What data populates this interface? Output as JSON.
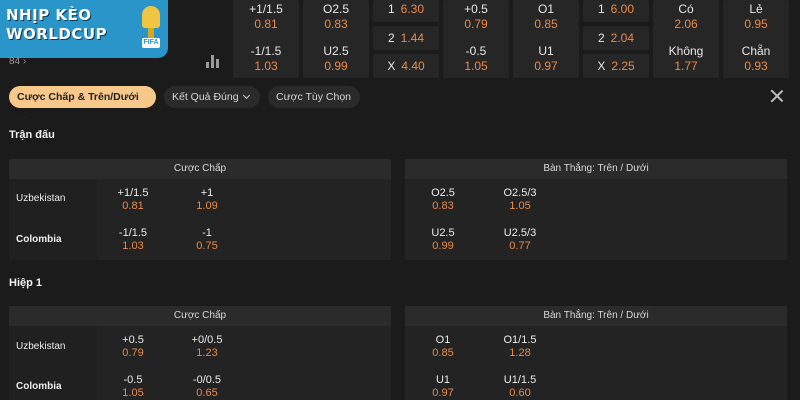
{
  "logo": {
    "line1": "NHỊP KÈO",
    "line2": "WORLDCUP",
    "badge": "FIFA"
  },
  "match_count": "84 ›",
  "top_odds": {
    "handicap": [
      {
        "line": "+1/1.5",
        "odds": "0.81"
      },
      {
        "line": "-1/1.5",
        "odds": "1.03"
      }
    ],
    "over_under": [
      {
        "line": "O2.5",
        "odds": "0.83"
      },
      {
        "line": "U2.5",
        "odds": "0.99"
      }
    ],
    "result_1x2": [
      {
        "label": "1",
        "odds": "6.30"
      },
      {
        "label": "2",
        "odds": "1.44"
      },
      {
        "label": "X",
        "odds": "4.40"
      }
    ],
    "ht_handicap": [
      {
        "line": "+0.5",
        "odds": "0.79"
      },
      {
        "line": "-0.5",
        "odds": "1.05"
      }
    ],
    "ht_over_under": [
      {
        "line": "O1",
        "odds": "0.85"
      },
      {
        "line": "U1",
        "odds": "0.97"
      }
    ],
    "ht_result_1x2": [
      {
        "label": "1",
        "odds": "6.00"
      },
      {
        "label": "2",
        "odds": "2.04"
      },
      {
        "label": "X",
        "odds": "2.25"
      }
    ],
    "btts": [
      {
        "line": "Có",
        "odds": "2.06"
      },
      {
        "line": "Không",
        "odds": "1.77"
      }
    ],
    "odd_even": [
      {
        "line": "Lẻ",
        "odds": "0.95"
      },
      {
        "line": "Chẵn",
        "odds": "0.93"
      }
    ]
  },
  "tabs": [
    {
      "label": "Cược Chấp & Trên/Dưới",
      "active": true
    },
    {
      "label": "Kết Quả Đúng",
      "active": false
    },
    {
      "label": "Cược Tùy Chọn",
      "active": false
    }
  ],
  "sections": [
    {
      "title": "Trận đấu",
      "handicap_header": "Cược Chấp",
      "ou_header": "Bàn Thắng: Trên / Dưới",
      "rows": [
        {
          "team": "Uzbekistan",
          "handicap": [
            {
              "line": "+1/1.5",
              "odds": "0.81"
            },
            {
              "line": "+1",
              "odds": "1.09"
            }
          ],
          "ou": [
            {
              "line": "O2.5",
              "odds": "0.83"
            },
            {
              "line": "O2.5/3",
              "odds": "1.05"
            }
          ]
        },
        {
          "team": "Colombia",
          "handicap": [
            {
              "line": "-1/1.5",
              "odds": "1.03"
            },
            {
              "line": "-1",
              "odds": "0.75"
            }
          ],
          "ou": [
            {
              "line": "U2.5",
              "odds": "0.99"
            },
            {
              "line": "U2.5/3",
              "odds": "0.77"
            }
          ]
        }
      ]
    },
    {
      "title": "Hiệp 1",
      "handicap_header": "Cược Chấp",
      "ou_header": "Bàn Thắng: Trên / Dưới",
      "rows": [
        {
          "team": "Uzbekistan",
          "handicap": [
            {
              "line": "+0.5",
              "odds": "0.79"
            },
            {
              "line": "+0/0.5",
              "odds": "1.23"
            }
          ],
          "ou": [
            {
              "line": "O1",
              "odds": "0.85"
            },
            {
              "line": "O1/1.5",
              "odds": "1.28"
            }
          ]
        },
        {
          "team": "Colombia",
          "handicap": [
            {
              "line": "-0.5",
              "odds": "1.05"
            },
            {
              "line": "-0/0.5",
              "odds": "0.65"
            }
          ],
          "ou": [
            {
              "line": "U1",
              "odds": "0.97"
            },
            {
              "line": "U1/1.5",
              "odds": "0.60"
            }
          ]
        }
      ]
    }
  ],
  "colors": {
    "background": "#1b1b1b",
    "odds": "#e98a4b",
    "active_tab": "#f6c88a",
    "logo_bg": "#2a95c9"
  },
  "icons": [
    "stats-bar-icon",
    "close-icon",
    "chevron-up-icon",
    "chevron-down-icon",
    "trophy-icon"
  ]
}
